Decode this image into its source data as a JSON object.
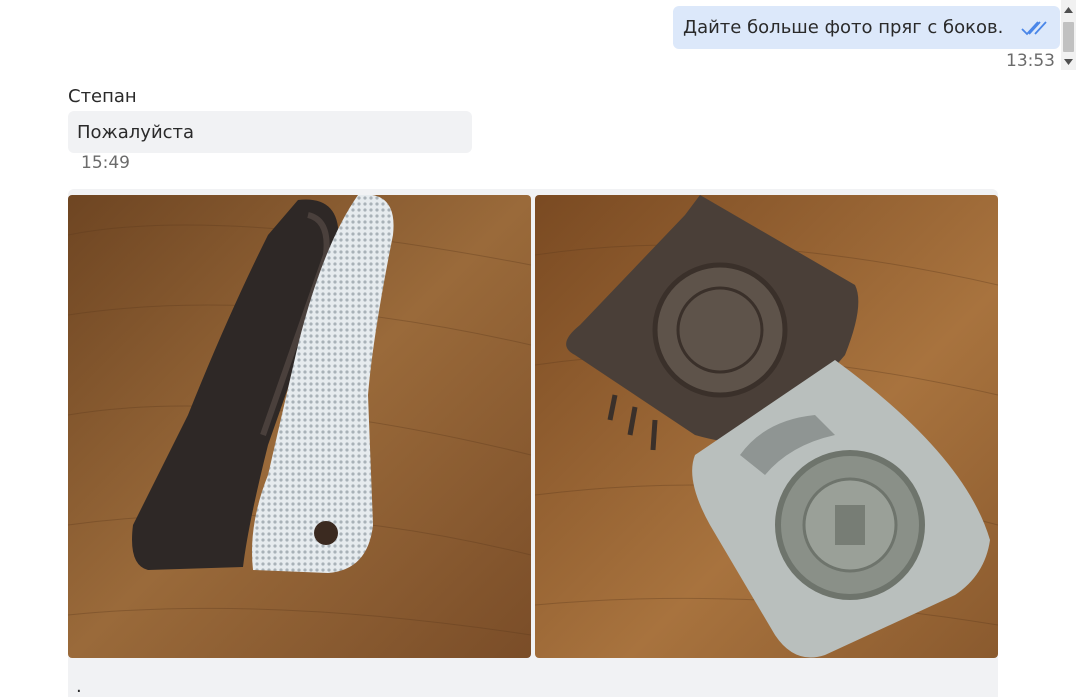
{
  "outgoing_message": {
    "text": "Дайте больше фото пряг с боков.",
    "time": "13:53",
    "status_icon": "double-check-read-icon"
  },
  "incoming_message": {
    "sender": "Степан",
    "text": "Пожалуйста",
    "time": "15:49"
  },
  "photo_message": {
    "photos": [
      {
        "name": "buckle-side-view",
        "icon": "photo"
      },
      {
        "name": "buckle-front-open",
        "icon": "photo"
      }
    ],
    "caption": "."
  },
  "colors": {
    "outgoing_bubble": "#dce8fa",
    "incoming_bubble": "#f1f2f4",
    "read_check": "#4a86e8",
    "wood": "#8a5a2e"
  }
}
